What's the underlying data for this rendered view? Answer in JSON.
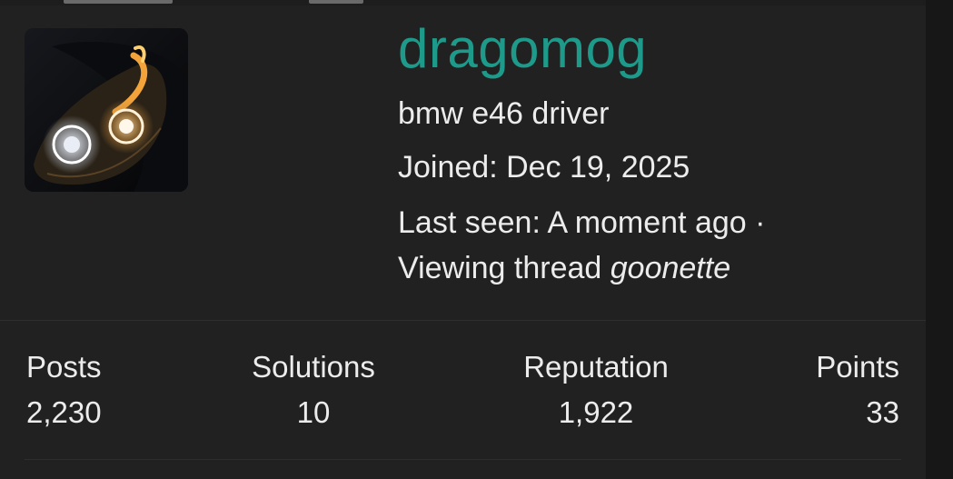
{
  "profile": {
    "username": "dragomog",
    "tagline": "bmw e46 driver",
    "joined": "Joined: Dec 19, 2025",
    "last_seen": "Last seen: A moment ago ·",
    "viewing_prefix": "Viewing thread ",
    "viewing_thread": "goonette",
    "avatar_icon": "car-headlight-avatar"
  },
  "stats": [
    {
      "label": "Posts",
      "value": "2,230"
    },
    {
      "label": "Solutions",
      "value": "10"
    },
    {
      "label": "Reputation",
      "value": "1,922"
    },
    {
      "label": "Points",
      "value": "33"
    }
  ],
  "colors": {
    "username": "#1e9a8a",
    "background": "#212121",
    "text": "#ececec"
  }
}
